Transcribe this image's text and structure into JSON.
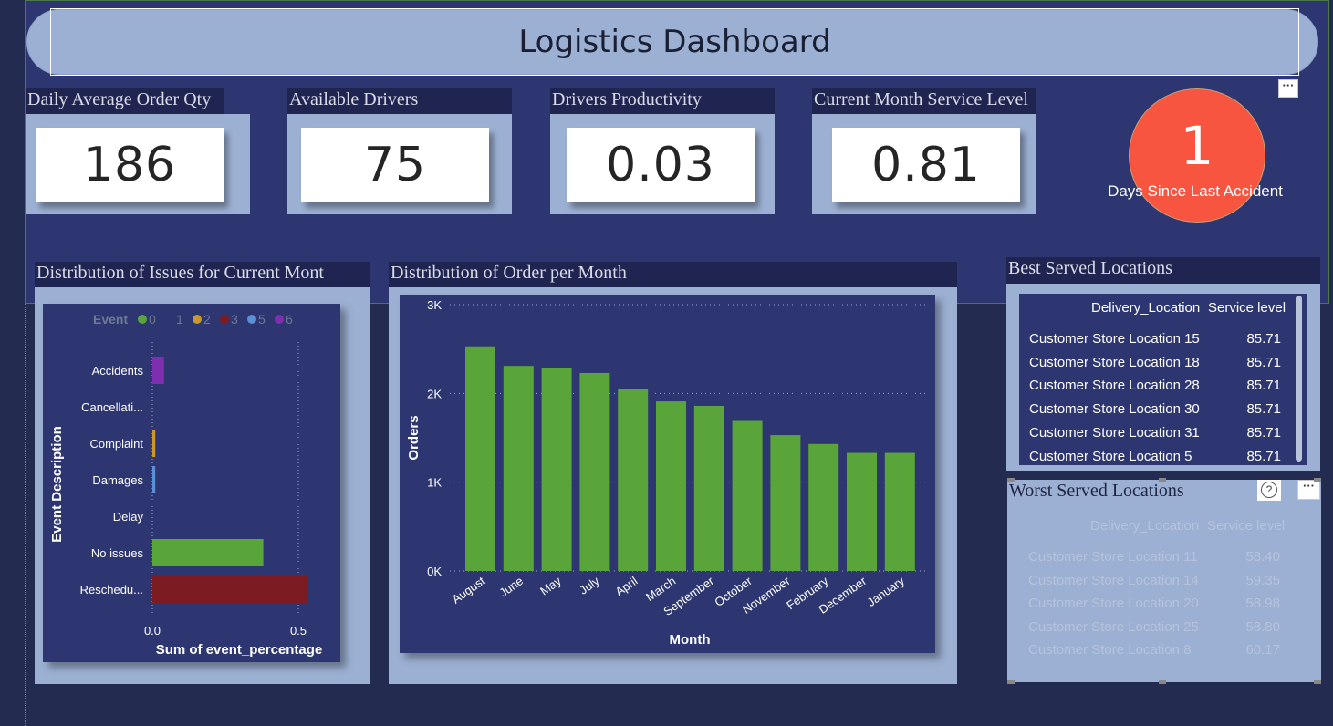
{
  "dashboard": {
    "title": "Logistics Dashboard",
    "more_icon": "···"
  },
  "kpis": [
    {
      "label": "Daily Average Order Qty",
      "value": "186"
    },
    {
      "label": "Available Drivers",
      "value": "75"
    },
    {
      "label": "Drivers Productivity",
      "value": "0.03"
    },
    {
      "label": "Current Month Service Level",
      "value": "0.81"
    }
  ],
  "accident": {
    "value": "1",
    "label": "Days Since Last Accident",
    "color": "#f85540"
  },
  "issues_chart": {
    "header": "Distribution of Issues for Current Mont",
    "legend_title": "Event",
    "legend": [
      {
        "name": "0",
        "color": "#5aa53a"
      },
      {
        "name": "1",
        "color": "#2d3670"
      },
      {
        "name": "2",
        "color": "#c9972b"
      },
      {
        "name": "3",
        "color": "#7d1b22"
      },
      {
        "name": "5",
        "color": "#5b8fd6"
      },
      {
        "name": "6",
        "color": "#7e2fb0"
      }
    ],
    "chart_data": {
      "type": "bar",
      "orientation": "horizontal",
      "categories": [
        "Accidents",
        "Cancellati...",
        "Complaint",
        "Damages",
        "Delay",
        "No issues",
        "Reschedu..."
      ],
      "values": [
        0.04,
        0.0,
        0.01,
        0.01,
        0.0,
        0.38,
        0.53
      ],
      "colors": [
        "#7e2fb0",
        "#2d3670",
        "#c9972b",
        "#5b8fd6",
        "#2d3670",
        "#5aa53a",
        "#7d1b22"
      ],
      "xlabel": "Sum of event_percentage",
      "ylabel": "Event Description",
      "xticks": [
        "0.0",
        "0.5"
      ],
      "xlim": [
        0,
        0.62
      ],
      "grid": true
    }
  },
  "orders_chart": {
    "header": "Distribution of Order per Month",
    "chart_data": {
      "type": "bar",
      "categories": [
        "August",
        "June",
        "May",
        "July",
        "April",
        "March",
        "September",
        "October",
        "November",
        "February",
        "December",
        "January"
      ],
      "values": [
        2530,
        2310,
        2290,
        2230,
        2050,
        1910,
        1860,
        1690,
        1530,
        1430,
        1330,
        1330
      ],
      "color": "#5aa53a",
      "xlabel": "Month",
      "ylabel": "Orders",
      "yticks": [
        "0K",
        "1K",
        "2K",
        "3K"
      ],
      "ylim": [
        0,
        3000
      ],
      "grid": true
    }
  },
  "best_locations": {
    "header": "Best Served Locations",
    "col_location": "Delivery_Location",
    "col_service": "Service level",
    "rows": [
      {
        "location": "Customer Store Location 15",
        "service": "85.71"
      },
      {
        "location": "Customer Store Location 18",
        "service": "85.71"
      },
      {
        "location": "Customer Store Location 28",
        "service": "85.71"
      },
      {
        "location": "Customer Store Location 30",
        "service": "85.71"
      },
      {
        "location": "Customer Store Location 31",
        "service": "85.71"
      },
      {
        "location": "Customer Store Location 5",
        "service": "85.71"
      }
    ]
  },
  "worst_locations": {
    "header": "Worst Served Locations",
    "help_icon": "?",
    "col_location": "Delivery_Location",
    "col_service": "Service level",
    "rows": [
      {
        "location": "Customer Store Location 11",
        "service": "58.40"
      },
      {
        "location": "Customer Store Location 14",
        "service": "59.35"
      },
      {
        "location": "Customer Store Location 20",
        "service": "58.98"
      },
      {
        "location": "Customer Store Location 25",
        "service": "58.80"
      },
      {
        "location": "Customer Store Location 8",
        "service": "60.17"
      }
    ]
  }
}
